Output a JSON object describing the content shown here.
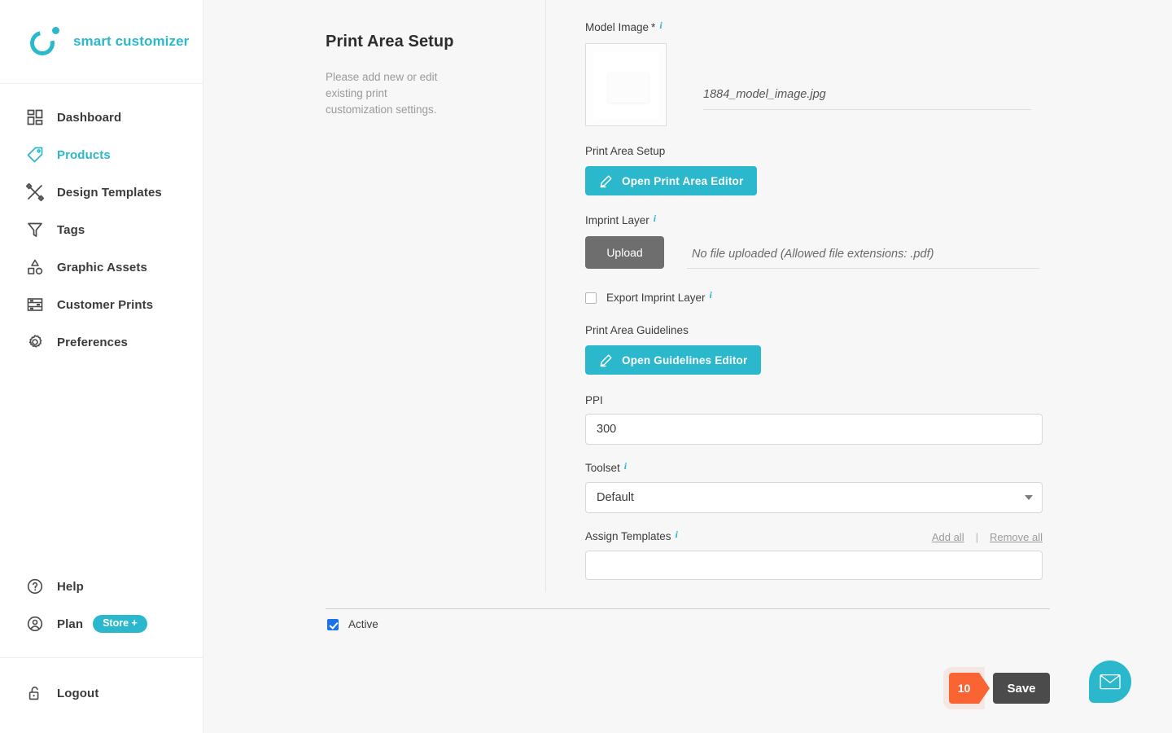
{
  "brand": {
    "name": "smart customizer",
    "logo_icon": "circle-dot-logo-icon",
    "accent_color": "#2bb8cc"
  },
  "sidebar": {
    "items": [
      {
        "label": "Dashboard",
        "icon": "grid-dashboard-icon",
        "active": false
      },
      {
        "label": "Products",
        "icon": "tag-icon",
        "active": true
      },
      {
        "label": "Design Templates",
        "icon": "pencil-ruler-icon",
        "active": false
      },
      {
        "label": "Tags",
        "icon": "funnel-icon",
        "active": false
      },
      {
        "label": "Graphic Assets",
        "icon": "shapes-icon",
        "active": false
      },
      {
        "label": "Customer Prints",
        "icon": "layout-rows-icon",
        "active": false
      },
      {
        "label": "Preferences",
        "icon": "gear-icon",
        "active": false
      }
    ],
    "bottom_items": [
      {
        "label": "Help",
        "icon": "question-circle-icon"
      },
      {
        "label": "Plan",
        "icon": "user-circle-icon",
        "badge": "Store +"
      }
    ],
    "logout": {
      "label": "Logout",
      "icon": "unlock-icon"
    }
  },
  "page": {
    "title": "Print Area Setup",
    "subtitle": "Please add new or edit existing print customization settings."
  },
  "form": {
    "model_image": {
      "label": "Model Image",
      "required_mark": "*",
      "info_icon": "info-icon",
      "filename": "1884_model_image.jpg",
      "thumbnail_alt": "model-image-thumbnail"
    },
    "print_area_setup": {
      "label": "Print Area Setup",
      "button_label": "Open Print Area Editor",
      "button_icon": "pencil-icon"
    },
    "imprint_layer": {
      "label": "Imprint Layer",
      "info_icon": "info-icon",
      "upload_label": "Upload",
      "file_placeholder": "No file uploaded (Allowed file extensions: .pdf)",
      "file_value": ""
    },
    "export_imprint_layer": {
      "label": "Export Imprint Layer",
      "info_icon": "info-icon",
      "checked": false
    },
    "print_area_guidelines": {
      "label": "Print Area Guidelines",
      "button_label": "Open Guidelines Editor",
      "button_icon": "pencil-icon"
    },
    "ppi": {
      "label": "PPI",
      "value": "300"
    },
    "toolset": {
      "label": "Toolset",
      "info_icon": "info-icon",
      "selected": "Default",
      "options": [
        "Default"
      ]
    },
    "assign_templates": {
      "label": "Assign Templates",
      "info_icon": "info-icon",
      "add_all_label": "Add all",
      "separator": "|",
      "remove_all_label": "Remove all",
      "value": ""
    }
  },
  "footer": {
    "active": {
      "label": "Active",
      "checked": true
    },
    "count_badge": "10",
    "save_label": "Save",
    "badge_color": "#fa6432"
  },
  "chat": {
    "icon": "envelope-chat-icon",
    "color": "#2bb8cc"
  }
}
